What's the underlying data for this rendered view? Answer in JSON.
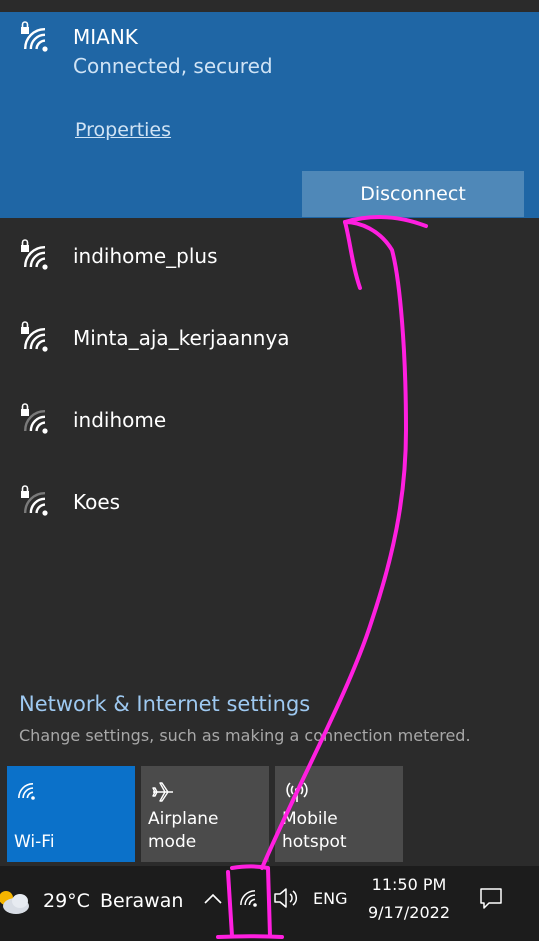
{
  "connected_network": {
    "name": "MIANK",
    "status": "Connected, secured",
    "properties_label": "Properties",
    "disconnect_label": "Disconnect"
  },
  "networks": [
    {
      "name": "indihome_plus",
      "signal": "full",
      "secured": true
    },
    {
      "name": "Minta_aja_kerjaannya",
      "signal": "full",
      "secured": true
    },
    {
      "name": "indihome",
      "signal": "weak",
      "secured": true
    },
    {
      "name": "Koes",
      "signal": "weak",
      "secured": true
    }
  ],
  "settings": {
    "link_label": "Network & Internet settings",
    "description": "Change settings, such as making a connection metered."
  },
  "quick_actions": [
    {
      "label": "Wi-Fi",
      "icon": "wifi-icon",
      "active": true
    },
    {
      "label": "Airplane mode",
      "icon": "airplane-icon",
      "active": false
    },
    {
      "label": "Mobile\nhotspot",
      "icon": "hotspot-icon",
      "active": false
    }
  ],
  "taskbar": {
    "weather_temp": "29°C",
    "weather_desc": "Berawan",
    "weather_icon": "partly-cloudy-icon",
    "language": "ENG",
    "time": "11:50 PM",
    "date": "9/17/2022"
  },
  "colors": {
    "panel_bg": "#2b2b2b",
    "connected_bg": "#1f66a5",
    "disconnect_bg": "#4f88b8",
    "accent_link": "#9ec9f1",
    "tile_active": "#0b71c9",
    "tile_inactive": "#4b4b4b",
    "taskbar_bg": "#1c1c1c",
    "annotation": "#ff1fe0"
  }
}
